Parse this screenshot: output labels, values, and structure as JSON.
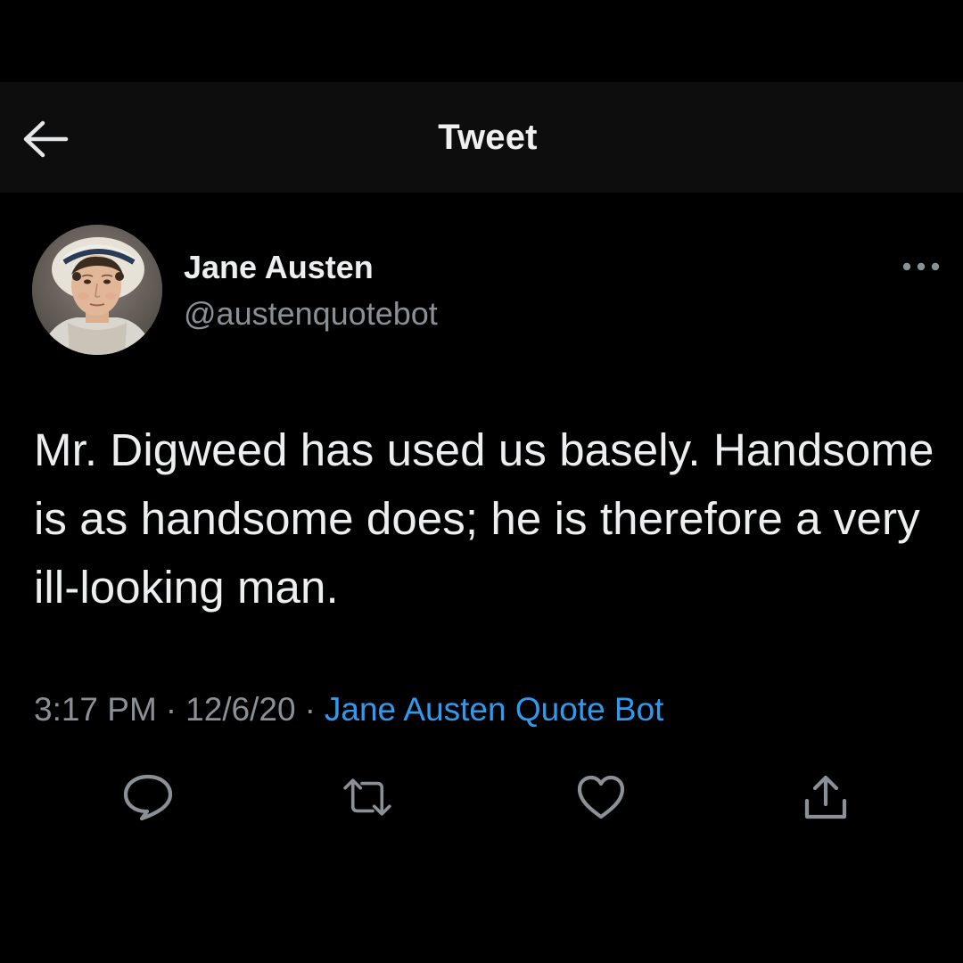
{
  "header": {
    "title": "Tweet",
    "back_icon": "arrow-left-icon"
  },
  "tweet": {
    "author_name": "Jane Austen",
    "author_handle": "@austenquotebot",
    "more_icon": "more-horizontal-icon",
    "text": "Mr. Digweed has used us basely. Handsome is as handsome does; he is therefore a very ill-looking man.",
    "time": "3:17 PM",
    "separator": "·",
    "date": "12/6/20",
    "source": "Jane Austen Quote Bot"
  },
  "actions": [
    {
      "icon": "reply-icon"
    },
    {
      "icon": "retweet-icon"
    },
    {
      "icon": "like-icon"
    },
    {
      "icon": "share-icon"
    }
  ],
  "colors": {
    "background": "#000000",
    "header_background": "#0d0d0d",
    "primary_text": "#eceeef",
    "secondary_text": "#8b9096",
    "link": "#2f9bf0"
  }
}
